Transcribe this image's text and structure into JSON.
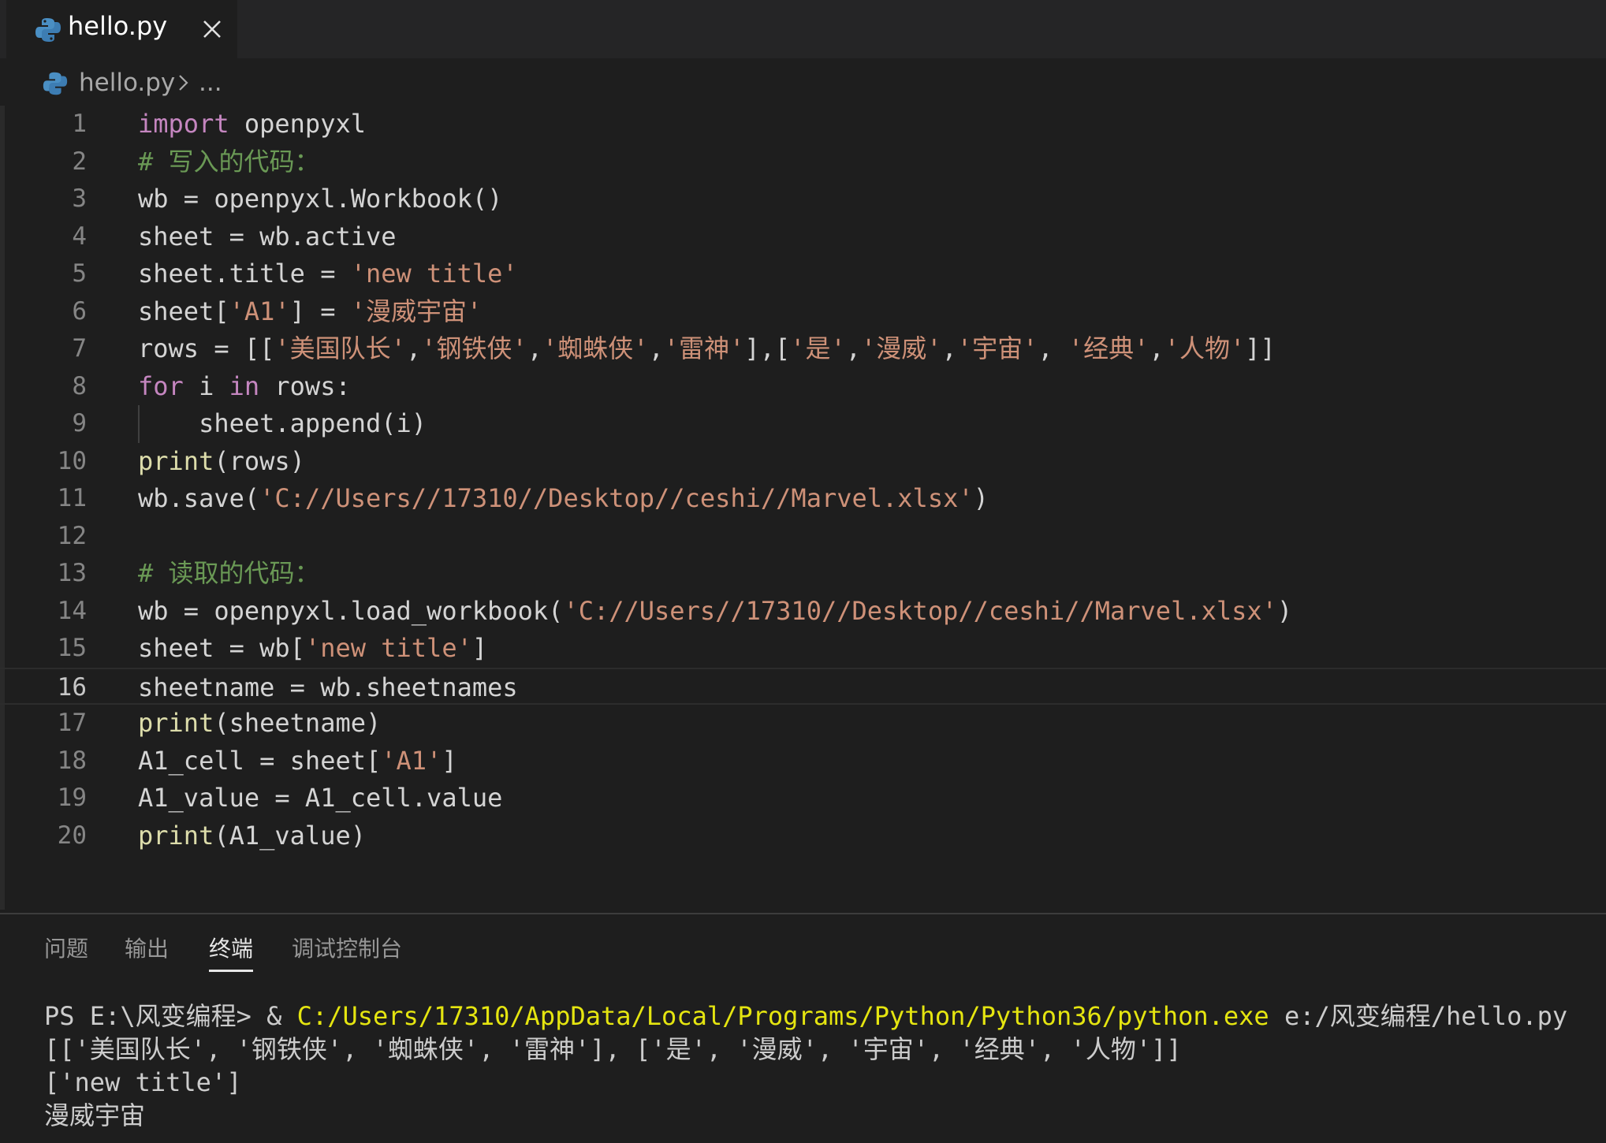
{
  "tab": {
    "filename": "hello.py",
    "icon": "python-file-icon"
  },
  "breadcrumb": {
    "file": "hello.py",
    "more": "..."
  },
  "editor": {
    "current_line": 16,
    "lines": [
      {
        "n": "1"
      },
      {
        "n": "2"
      },
      {
        "n": "3"
      },
      {
        "n": "4"
      },
      {
        "n": "5"
      },
      {
        "n": "6"
      },
      {
        "n": "7"
      },
      {
        "n": "8"
      },
      {
        "n": "9"
      },
      {
        "n": "10"
      },
      {
        "n": "11"
      },
      {
        "n": "12"
      },
      {
        "n": "13"
      },
      {
        "n": "14"
      },
      {
        "n": "15"
      },
      {
        "n": "16"
      },
      {
        "n": "17"
      },
      {
        "n": "18"
      },
      {
        "n": "19"
      },
      {
        "n": "20"
      }
    ],
    "code": {
      "l1_kw": "import",
      "l1_rest": " openpyxl",
      "l2": "# 写入的代码：",
      "l3": "wb = openpyxl.Workbook()",
      "l4": "sheet = wb.active",
      "l5_a": "sheet.title = ",
      "l5_s": "'new title'",
      "l6_a": "sheet[",
      "l6_s1": "'A1'",
      "l6_b": "] = ",
      "l6_s2": "'漫威宇宙'",
      "l7_a": "rows = [[",
      "l7_s1": "'美国队长'",
      "l7_c1": ",",
      "l7_s2": "'钢铁侠'",
      "l7_c2": ",",
      "l7_s3": "'蜘蛛侠'",
      "l7_c3": ",",
      "l7_s4": "'雷神'",
      "l7_c4": "],[",
      "l7_s5": "'是'",
      "l7_c5": ",",
      "l7_s6": "'漫威'",
      "l7_c6": ",",
      "l7_s7": "'宇宙'",
      "l7_c7": ", ",
      "l7_s8": "'经典'",
      "l7_c8": ",",
      "l7_s9": "'人物'",
      "l7_c9": "]]",
      "l8_kw1": "for",
      "l8_a": " i ",
      "l8_kw2": "in",
      "l8_b": " rows:",
      "l9": "    sheet.append(i)",
      "l10_fn": "print",
      "l10_rest": "(rows)",
      "l11_a": "wb.save(",
      "l11_s": "'C://Users//17310//Desktop//ceshi//Marvel.xlsx'",
      "l11_b": ")",
      "l12": "",
      "l13": "# 读取的代码：",
      "l14_a": "wb = openpyxl.load_workbook(",
      "l14_s": "'C://Users//17310//Desktop//ceshi//Marvel.xlsx'",
      "l14_b": ")",
      "l15_a": "sheet = wb[",
      "l15_s": "'new title'",
      "l15_b": "]",
      "l16": "sheetname = wb.sheetnames",
      "l17_fn": "print",
      "l17_rest": "(sheetname)",
      "l18_a": "A1_cell = sheet[",
      "l18_s": "'A1'",
      "l18_b": "]",
      "l19": "A1_value = A1_cell.value",
      "l20_fn": "print",
      "l20_rest": "(A1_value)"
    }
  },
  "panel": {
    "tabs": [
      "问题",
      "输出",
      "终端",
      "调试控制台"
    ],
    "active_tab": "终端"
  },
  "terminal": {
    "prompt": "PS E:\\风变编程> & ",
    "exe_path": "C:/Users/17310/AppData/Local/Programs/Python/Python36/python.exe",
    "script_arg": " e:/风变编程/hello.py",
    "out1": "[['美国队长', '钢铁侠', '蜘蛛侠', '雷神'], ['是', '漫威', '宇宙', '经典', '人物']]",
    "out2": "['new title']",
    "out3": "漫威宇宙"
  },
  "colors": {
    "background": "#1e1e1e",
    "keyword": "#c586c0",
    "function": "#dcdcaa",
    "string": "#ce9178",
    "comment": "#6a9955",
    "terminal_path": "#e5e510"
  }
}
